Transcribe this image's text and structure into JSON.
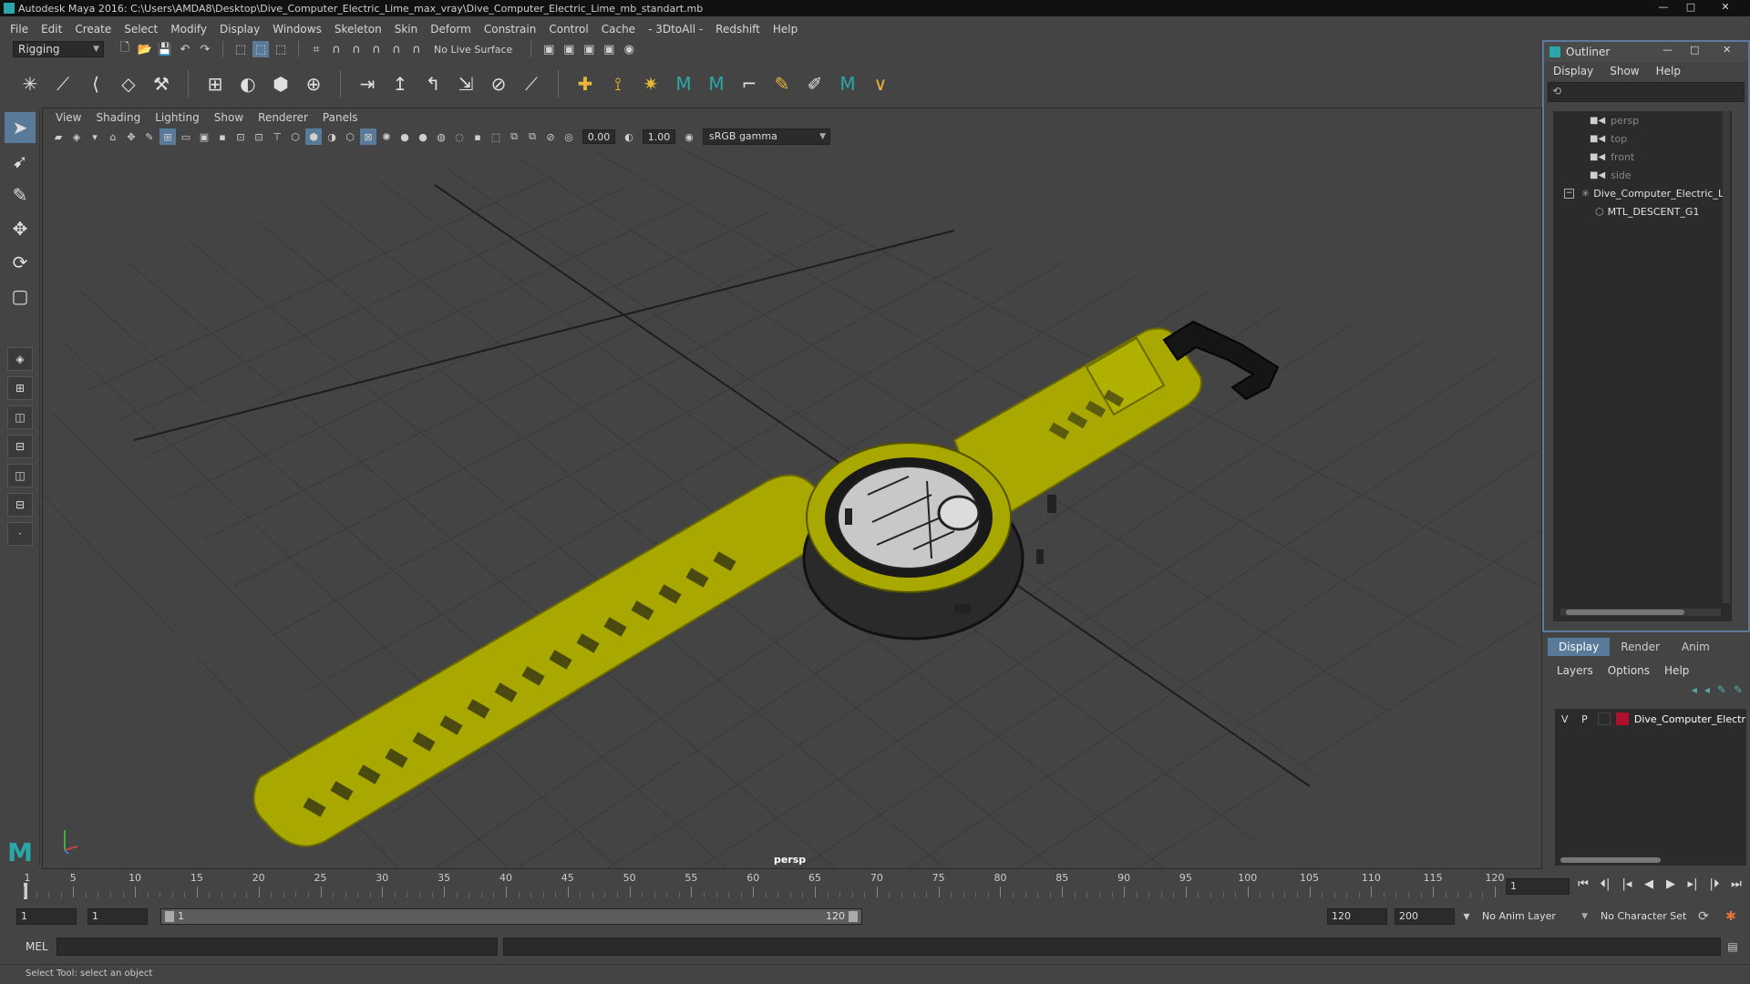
{
  "window": {
    "title": "Autodesk Maya 2016: C:\\Users\\AMDA8\\Desktop\\Dive_Computer_Electric_Lime_max_vray\\Dive_Computer_Electric_Lime_mb_standart.mb",
    "minimize": "—",
    "maximize": "□",
    "close": "✕"
  },
  "menubar": [
    "File",
    "Edit",
    "Create",
    "Select",
    "Modify",
    "Display",
    "Windows",
    "Skeleton",
    "Skin",
    "Deform",
    "Constrain",
    "Control",
    "Cache",
    "- 3DtoAll -",
    "Redshift",
    "Help"
  ],
  "status_line": {
    "mode": "Rigging",
    "live_surface": "No Live Surface"
  },
  "viewport": {
    "menus": [
      "View",
      "Shading",
      "Lighting",
      "Show",
      "Renderer",
      "Panels"
    ],
    "near_value": "0.00",
    "far_value": "1.00",
    "color_space": "sRGB gamma",
    "camera_label": "persp"
  },
  "outliner": {
    "title": "Outliner",
    "menus": [
      "Display",
      "Show",
      "Help"
    ],
    "cameras": [
      "persp",
      "top",
      "front",
      "side"
    ],
    "group": "Dive_Computer_Electric_Li",
    "child": "MTL_DESCENT_G1"
  },
  "layer_editor": {
    "tabs": [
      "Display",
      "Render",
      "Anim"
    ],
    "active_tab": "Display",
    "menus": [
      "Layers",
      "Options",
      "Help"
    ],
    "layer": {
      "v": "V",
      "p": "P",
      "name": "Dive_Computer_Electri",
      "color": "#b01030"
    }
  },
  "time_slider": {
    "ticks": [
      "1",
      "5",
      "10",
      "15",
      "20",
      "25",
      "30",
      "35",
      "40",
      "45",
      "50",
      "55",
      "60",
      "65",
      "70",
      "75",
      "80",
      "85",
      "90",
      "95",
      "100",
      "105",
      "110",
      "115",
      "120"
    ],
    "current_frame": "1"
  },
  "range_slider": {
    "start_time": "1",
    "playback_start": "1",
    "range_start_label": "1",
    "range_end_label": "120",
    "playback_end": "120",
    "end_time": "200",
    "anim_layer": "No Anim Layer",
    "character_set": "No Character Set"
  },
  "command_line": {
    "label": "MEL"
  },
  "help_line": {
    "text": "Select Tool: select an object"
  },
  "colors": {
    "accent": "#5a7a9a",
    "strap": "#b8b800",
    "maya_teal": "#2aa7a8"
  }
}
